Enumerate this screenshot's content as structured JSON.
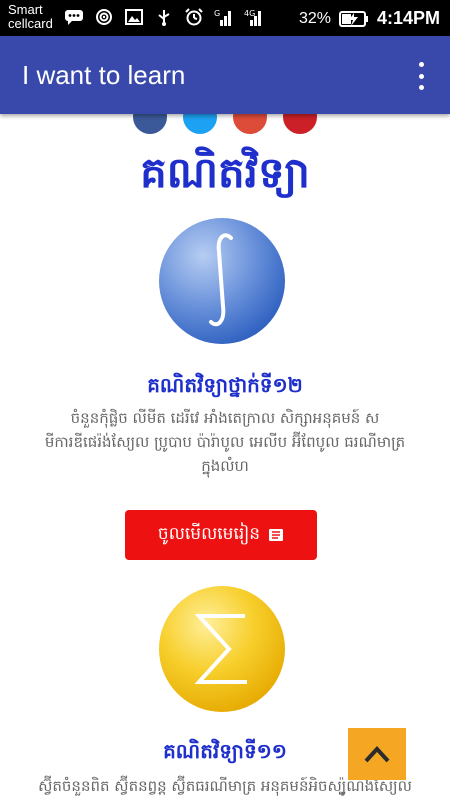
{
  "status_bar": {
    "carrier_line1": "Smart",
    "carrier_line2": "cellcard",
    "battery_percent": "32%",
    "time": "4:14PM",
    "icons": [
      "chat-icon",
      "hotspot-icon",
      "image-icon",
      "usb-icon",
      "alarm-icon",
      "signal-g-icon",
      "signal-4g-icon",
      "battery-charging-icon"
    ]
  },
  "app_bar": {
    "title": "I want to learn",
    "menu_icon": "more-vert-icon"
  },
  "social_icons": [
    "facebook-icon",
    "twitter-icon",
    "google-plus-icon",
    "pinterest-icon"
  ],
  "main": {
    "heading": "គណិតវិទ្យា",
    "courses": [
      {
        "title": "គណិតវិទ្យាថ្នាក់ទី១២",
        "description": "ចំនួនកុំផ្លិច លីមីត ដេរីវេ អាំងតេក្រាល សិក្សាអនុគមន៍ ស មីការឌីផេរ៉ង់ស្យែល ប្រូបាប ប៉ារ៉ាបូល អេលីប អ៊ីពែបូល ធរណីមាត្រ ក្នុងលំហ",
        "icon": "integral-icon",
        "button_label": "ចូលមើលមេរៀន",
        "button_icon": "book-icon"
      },
      {
        "title": "គណិតវិទ្យាទី១១",
        "description": "ស្វ៊ីតចំនួនពិត ស្វ៊ីតនព្វន្ត ស្វ៊ីតធរណីមាត្រ អនុគមន៍អិចស្ប៉ូណង់ស្យែល",
        "icon": "sigma-icon"
      }
    ]
  },
  "scroll_top": {
    "icon": "chevron-up-icon"
  },
  "colors": {
    "app_bar": "#3949ab",
    "heading": "#1f2fcb",
    "button": "#ee1111",
    "scroll_top": "#f5a623"
  }
}
